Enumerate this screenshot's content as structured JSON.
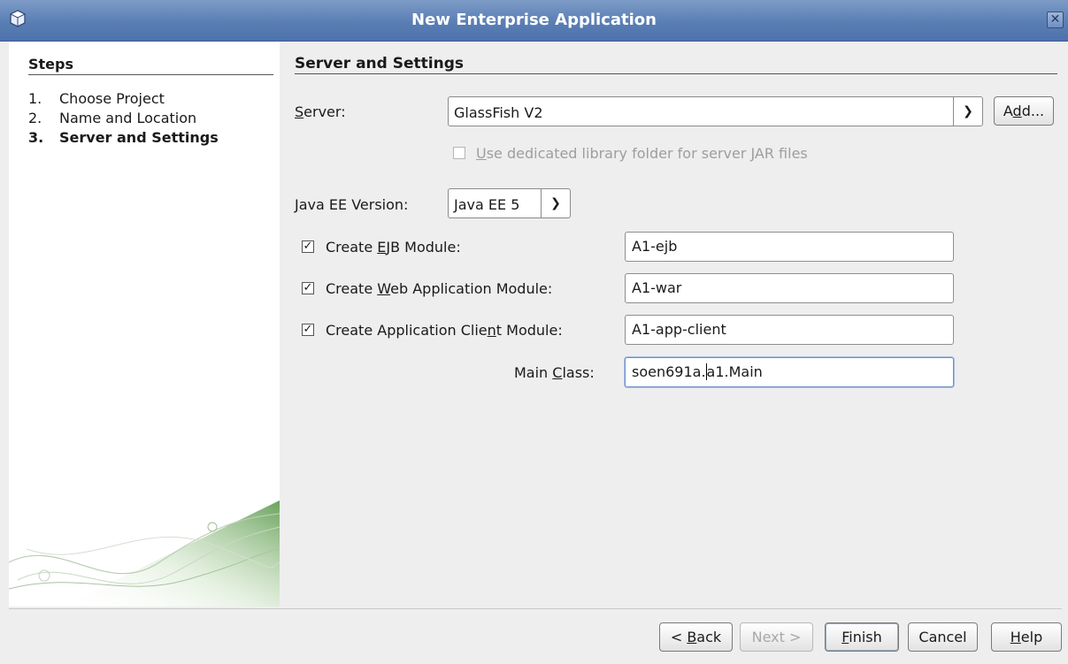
{
  "window": {
    "title": "New Enterprise Application"
  },
  "steps": {
    "title": "Steps",
    "items": [
      {
        "num": "1.",
        "label": "Choose Project",
        "active": false
      },
      {
        "num": "2.",
        "label": "Name and Location",
        "active": false
      },
      {
        "num": "3.",
        "label": "Server and Settings",
        "active": true
      }
    ]
  },
  "main": {
    "section_title": "Server and Settings",
    "server": {
      "label_u": "S",
      "label_rest": "erver:",
      "value": "GlassFish V2",
      "add_pre": "A",
      "add_u": "d",
      "add_post": "d..."
    },
    "dedicated_lib": {
      "label_u": "U",
      "label_rest": "se dedicated library folder for server JAR files",
      "checked": false,
      "enabled": false
    },
    "java_ee": {
      "label_u": "J",
      "label_rest": "ava EE Version:",
      "value": "Java EE 5"
    },
    "ejb_module": {
      "label_pre": "Create ",
      "label_u": "E",
      "label_rest": "JB Module:",
      "checked": true,
      "value": "A1-ejb"
    },
    "web_module": {
      "label_pre": "Create ",
      "label_u": "W",
      "label_rest": "eb Application Module:",
      "checked": true,
      "value": "A1-war"
    },
    "client_module": {
      "label_pre": "Create Application Clie",
      "label_u": "n",
      "label_rest": "t Module:",
      "checked": true,
      "value": "A1-app-client"
    },
    "main_class": {
      "label_pre": "Main ",
      "label_u": "C",
      "label_rest": "lass:",
      "value_before_caret": "soen691a.",
      "value_after_caret": "a1.Main"
    }
  },
  "buttons": {
    "back": {
      "pre": "< ",
      "u": "B",
      "rest": "ack"
    },
    "next": {
      "label": "Next >"
    },
    "finish": {
      "u": "F",
      "rest": "inish"
    },
    "cancel": {
      "label": "Cancel"
    },
    "help": {
      "u": "H",
      "rest": "elp"
    }
  },
  "colors": {
    "titlebar": "#5a7eb4",
    "panel": "#ffffff",
    "background": "#eeeeee"
  }
}
